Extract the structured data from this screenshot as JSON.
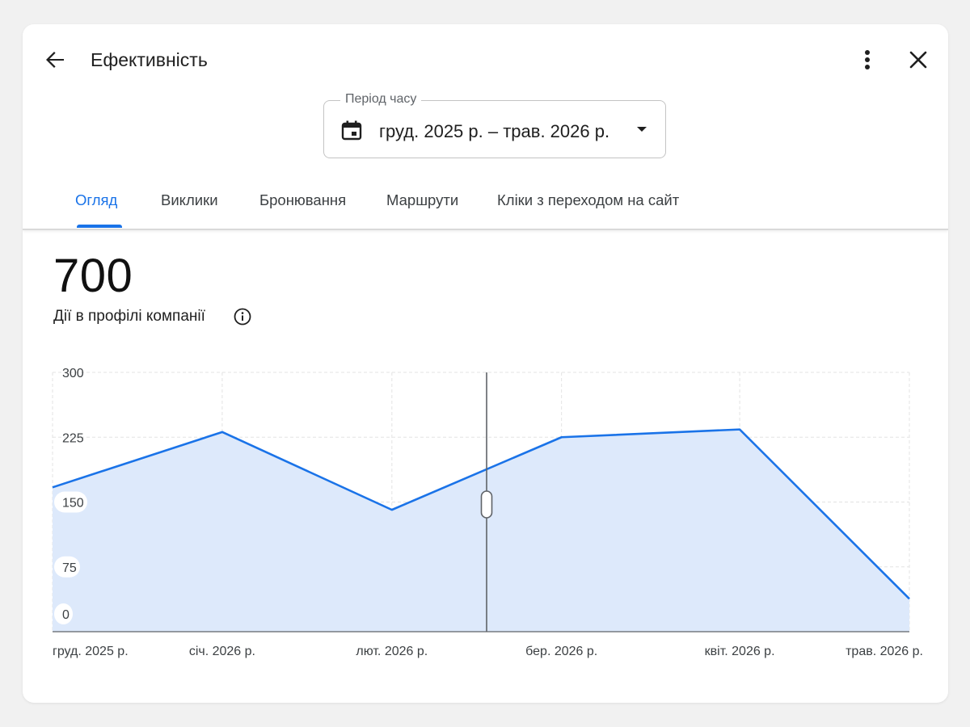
{
  "header": {
    "title": "Ефективність",
    "back_icon": "arrow-back-icon",
    "more_icon": "more-vert-icon",
    "close_icon": "close-icon"
  },
  "period": {
    "legend": "Період часу",
    "value": "груд. 2025 р. – трав. 2026 р.",
    "icon": "calendar-icon"
  },
  "tabs": [
    {
      "label": "Огляд",
      "active": true
    },
    {
      "label": "Виклики"
    },
    {
      "label": "Бронювання"
    },
    {
      "label": "Маршрути"
    },
    {
      "label": "Кліки з переходом на сайт"
    }
  ],
  "summary": {
    "total": "700",
    "label": "Дії в профілі компанії",
    "info_icon": "info-icon"
  },
  "colors": {
    "accent": "#1a73e8",
    "area_fill": "#dde9fb"
  },
  "chart_data": {
    "type": "area",
    "x": [
      "груд. 2025 р.",
      "січ. 2026 р.",
      "лют. 2026 р.",
      "бер. 2026 р.",
      "квіт. 2026 р.",
      "трав. 2026 р."
    ],
    "x_positions": [
      0,
      1,
      2,
      3,
      4.05,
      5.05
    ],
    "values": [
      167,
      231,
      141,
      225,
      234,
      38
    ],
    "y_ticks": [
      "300",
      "225",
      "150",
      "75",
      "0"
    ],
    "ylim": [
      0,
      300
    ],
    "grid": true,
    "scrubber": true
  }
}
